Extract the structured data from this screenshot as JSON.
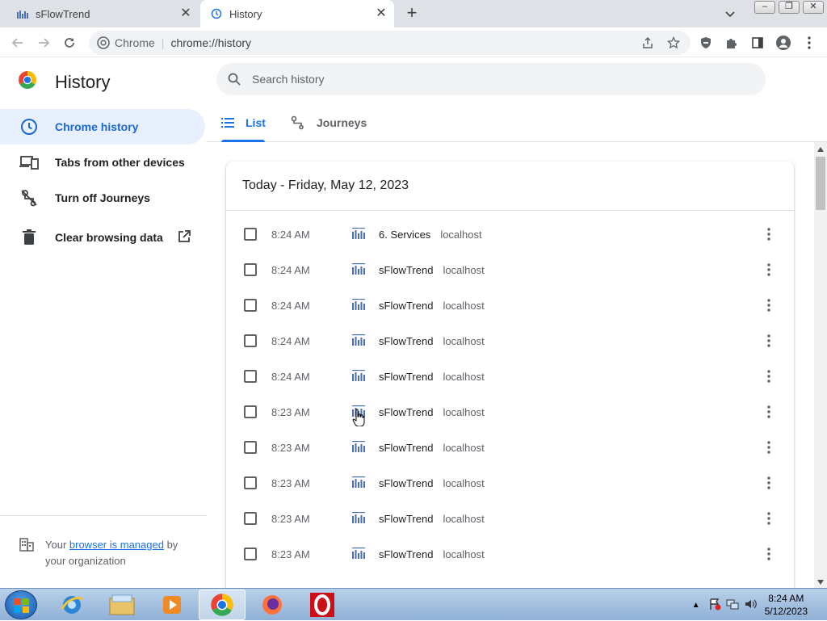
{
  "browser": {
    "tabs": [
      {
        "title": "sFlowTrend",
        "active": false
      },
      {
        "title": "History",
        "active": true
      }
    ],
    "omnibox": {
      "site": "Chrome",
      "url": "chrome://history"
    }
  },
  "sidebar": {
    "title": "History",
    "items": [
      {
        "label": "Chrome history",
        "active": true
      },
      {
        "label": "Tabs from other devices"
      },
      {
        "label": "Turn off Journeys"
      },
      {
        "label": "Clear browsing data"
      }
    ],
    "managed": {
      "prefix": "Your ",
      "link": "browser is managed",
      "suffix": " by",
      "line2": "your organization"
    }
  },
  "search": {
    "placeholder": "Search history"
  },
  "view_tabs": [
    {
      "label": "List",
      "active": true
    },
    {
      "label": "Journeys",
      "active": false
    }
  ],
  "history": {
    "date_header": "Today - Friday, May 12, 2023",
    "rows": [
      {
        "time": "8:24 AM",
        "title": "6. Services",
        "domain": "localhost"
      },
      {
        "time": "8:24 AM",
        "title": "sFlowTrend",
        "domain": "localhost"
      },
      {
        "time": "8:24 AM",
        "title": "sFlowTrend",
        "domain": "localhost"
      },
      {
        "time": "8:24 AM",
        "title": "sFlowTrend",
        "domain": "localhost"
      },
      {
        "time": "8:24 AM",
        "title": "sFlowTrend",
        "domain": "localhost"
      },
      {
        "time": "8:23 AM",
        "title": "sFlowTrend",
        "domain": "localhost"
      },
      {
        "time": "8:23 AM",
        "title": "sFlowTrend",
        "domain": "localhost"
      },
      {
        "time": "8:23 AM",
        "title": "sFlowTrend",
        "domain": "localhost"
      },
      {
        "time": "8:23 AM",
        "title": "sFlowTrend",
        "domain": "localhost"
      },
      {
        "time": "8:23 AM",
        "title": "sFlowTrend",
        "domain": "localhost"
      }
    ]
  },
  "taskbar": {
    "clock_time": "8:24 AM",
    "clock_date": "5/12/2023"
  },
  "colors": {
    "accent": "#1a73e8",
    "active_bg": "#e8f0fe"
  }
}
